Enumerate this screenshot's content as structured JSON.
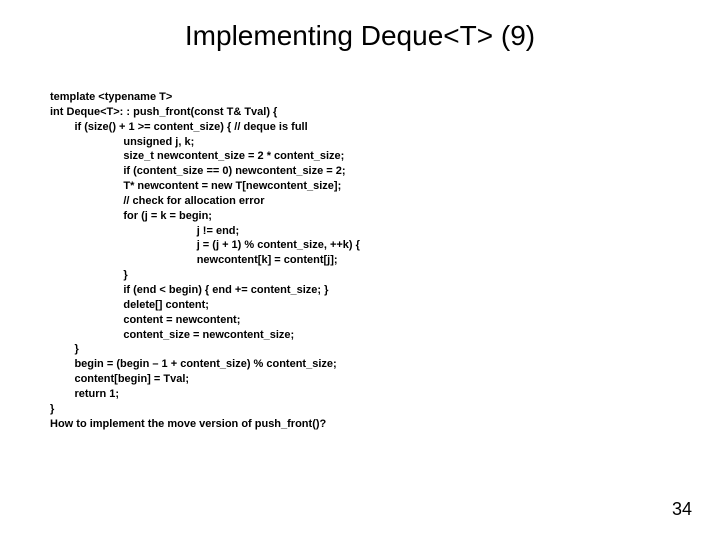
{
  "slide": {
    "title": "Implementing Deque<T> (9)",
    "code": "template <typename T>\nint Deque<T>: : push_front(const T& Tval) {\n        if (size() + 1 >= content_size) { // deque is full\n                        unsigned j, k;\n                        size_t newcontent_size = 2 * content_size;\n                        if (content_size == 0) newcontent_size = 2;\n                        T* newcontent = new T[newcontent_size];\n                        // check for allocation error\n                        for (j = k = begin;\n                                                j != end;\n                                                j = (j + 1) % content_size, ++k) {\n                                                newcontent[k] = content[j];\n                        }\n                        if (end < begin) { end += content_size; }\n                        delete[] content;\n                        content = newcontent;\n                        content_size = newcontent_size;\n        }\n        begin = (begin – 1 + content_size) % content_size;\n        content[begin] = Tval;\n        return 1;\n}\nHow to implement the move version of push_front()?",
    "page_number": "34"
  }
}
